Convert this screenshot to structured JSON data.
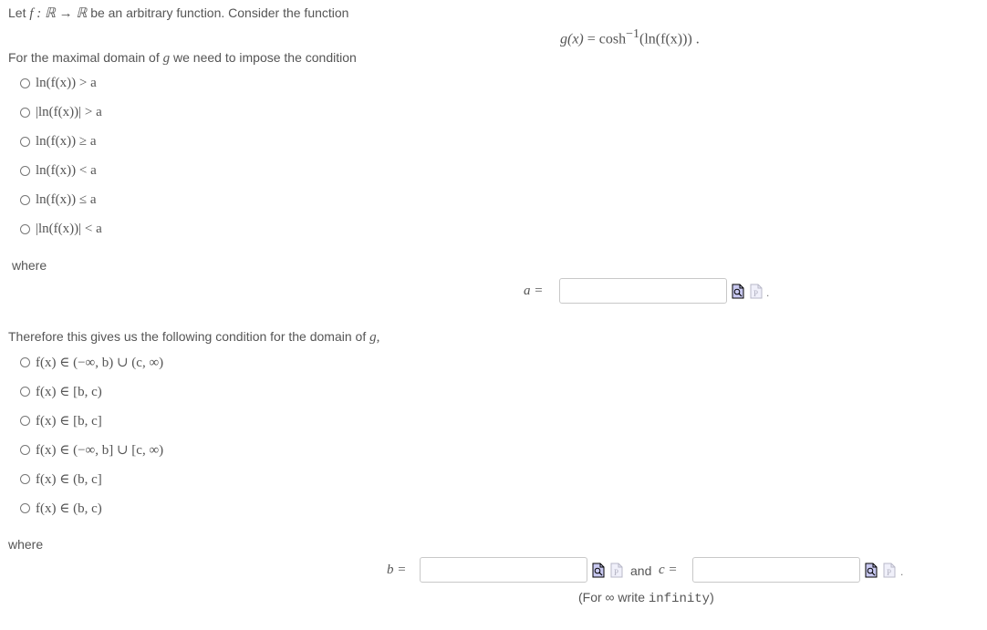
{
  "intro": {
    "prefix": "Let",
    "fmap": "f : ℝ → ℝ",
    "suffix": "be an arbitrary function. Consider the function"
  },
  "formula": {
    "lhs": "g(x)",
    "eq": "=",
    "rhs": "cosh",
    "sup": "−1",
    "arg": "(ln(f(x))) ."
  },
  "question1": {
    "text_before": "For the maximal domain of",
    "var": "g",
    "text_after": "we need to impose the condition",
    "options": [
      "ln(f(x)) > a",
      "|ln(f(x))| > a",
      "ln(f(x)) ≥ a",
      "ln(f(x)) < a",
      "ln(f(x)) ≤ a",
      "|ln(f(x))| < a"
    ]
  },
  "where1": "where",
  "answer_a": {
    "label": "a =",
    "value": "",
    "trailing": "."
  },
  "question2": {
    "text": "Therefore this gives us the following condition for the domain of",
    "var": "g,",
    "options": [
      "f(x) ∈ (−∞, b) ∪ (c, ∞)",
      "f(x) ∈ [b, c)",
      "f(x) ∈ [b, c]",
      "f(x) ∈ (−∞, b] ∪ [c, ∞)",
      "f(x) ∈ (b, c]",
      "f(x) ∈ (b, c)"
    ]
  },
  "where2": "where",
  "answer_b": {
    "label": "b =",
    "value": ""
  },
  "and_label": "and",
  "answer_c": {
    "label": "c =",
    "value": "",
    "trailing": "."
  },
  "hint": {
    "prefix": "(For ∞ write",
    "code": "infinity",
    "suffix": ")"
  },
  "icons": {
    "preview": "preview-icon",
    "syntax": "syntax-p-icon"
  }
}
